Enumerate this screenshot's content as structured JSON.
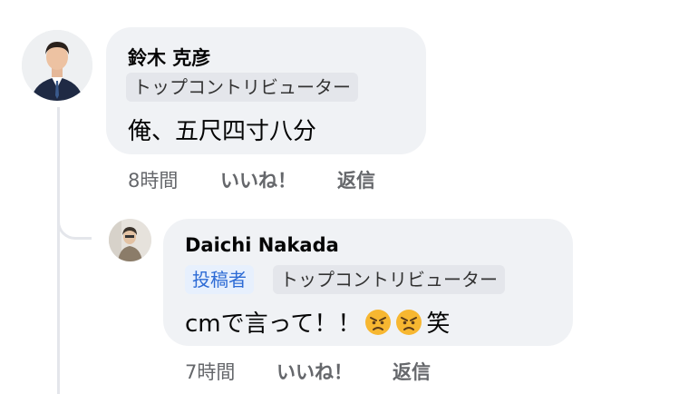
{
  "comments": [
    {
      "author": "鈴木 克彦",
      "badges": [
        "トップコントリビューター"
      ],
      "text": "俺、五尺四寸八分",
      "time": "8時間",
      "like_label": "いいね！",
      "reply_label": "返信"
    },
    {
      "author": "Daichi Nakada",
      "badges": [
        "投稿者",
        "トップコントリビューター"
      ],
      "text": "cmで言って！！",
      "emojis": [
        "angry-face-icon",
        "angry-face-icon"
      ],
      "text_suffix": "笑",
      "time": "7時間",
      "like_label": "いいね！",
      "reply_label": "返信"
    }
  ],
  "colors": {
    "bubble": "#f0f2f5",
    "badge": "#e4e6eb",
    "op_badge_bg": "#e7f0fd",
    "op_badge_text": "#2d6bd5",
    "meta_text": "#65676b",
    "thread_line": "#e4e6eb"
  }
}
